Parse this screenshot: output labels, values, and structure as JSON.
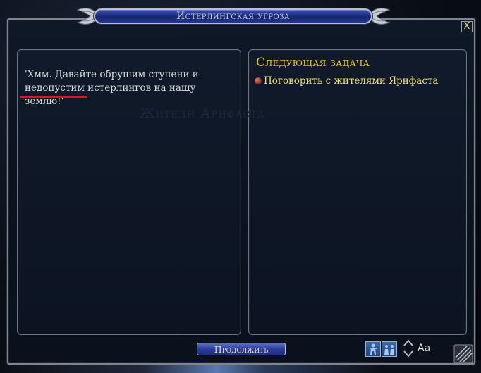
{
  "window": {
    "title": "Истерлингская угроза",
    "close_symbol": "X"
  },
  "dialog": {
    "line1": "'Хмм. Давайте обрушим ступени и",
    "line2": "недопустим истерлингов на нашу",
    "line3": "землю!'"
  },
  "watermark": {
    "text": "Жители Арнфаста"
  },
  "objectives": {
    "heading": "Следующая задача",
    "tasks": [
      {
        "label": "Поговорить с жителями Ярнфаста"
      }
    ]
  },
  "footer": {
    "continue_label": "Продолжить",
    "font_size_label": "Aa"
  },
  "icons": {
    "title_ornament": "leaf-wing-icon",
    "close": "close-icon",
    "bullet": "quest-bullet-icon",
    "people_one": "single-person-icon",
    "people_group": "group-people-icon",
    "font_arrows": "font-size-arrows-icon",
    "resize": "resize-grip-icon"
  },
  "colors": {
    "title_bar": "#1e2f86",
    "heading_gold": "#f0c820",
    "task_yellow": "#f2e070",
    "annotation_red": "#e0141e"
  }
}
